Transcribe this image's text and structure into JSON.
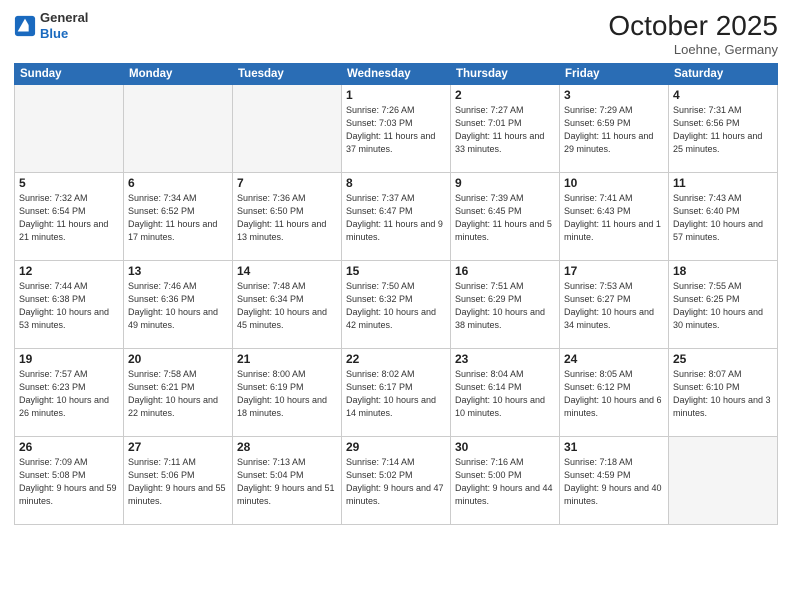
{
  "header": {
    "logo_general": "General",
    "logo_blue": "Blue",
    "month_title": "October 2025",
    "location": "Loehne, Germany"
  },
  "weekdays": [
    "Sunday",
    "Monday",
    "Tuesday",
    "Wednesday",
    "Thursday",
    "Friday",
    "Saturday"
  ],
  "weeks": [
    [
      {
        "day": "",
        "empty": true
      },
      {
        "day": "",
        "empty": true
      },
      {
        "day": "",
        "empty": true
      },
      {
        "day": "1",
        "sunrise": "Sunrise: 7:26 AM",
        "sunset": "Sunset: 7:03 PM",
        "daylight": "Daylight: 11 hours and 37 minutes."
      },
      {
        "day": "2",
        "sunrise": "Sunrise: 7:27 AM",
        "sunset": "Sunset: 7:01 PM",
        "daylight": "Daylight: 11 hours and 33 minutes."
      },
      {
        "day": "3",
        "sunrise": "Sunrise: 7:29 AM",
        "sunset": "Sunset: 6:59 PM",
        "daylight": "Daylight: 11 hours and 29 minutes."
      },
      {
        "day": "4",
        "sunrise": "Sunrise: 7:31 AM",
        "sunset": "Sunset: 6:56 PM",
        "daylight": "Daylight: 11 hours and 25 minutes."
      }
    ],
    [
      {
        "day": "5",
        "sunrise": "Sunrise: 7:32 AM",
        "sunset": "Sunset: 6:54 PM",
        "daylight": "Daylight: 11 hours and 21 minutes."
      },
      {
        "day": "6",
        "sunrise": "Sunrise: 7:34 AM",
        "sunset": "Sunset: 6:52 PM",
        "daylight": "Daylight: 11 hours and 17 minutes."
      },
      {
        "day": "7",
        "sunrise": "Sunrise: 7:36 AM",
        "sunset": "Sunset: 6:50 PM",
        "daylight": "Daylight: 11 hours and 13 minutes."
      },
      {
        "day": "8",
        "sunrise": "Sunrise: 7:37 AM",
        "sunset": "Sunset: 6:47 PM",
        "daylight": "Daylight: 11 hours and 9 minutes."
      },
      {
        "day": "9",
        "sunrise": "Sunrise: 7:39 AM",
        "sunset": "Sunset: 6:45 PM",
        "daylight": "Daylight: 11 hours and 5 minutes."
      },
      {
        "day": "10",
        "sunrise": "Sunrise: 7:41 AM",
        "sunset": "Sunset: 6:43 PM",
        "daylight": "Daylight: 11 hours and 1 minute."
      },
      {
        "day": "11",
        "sunrise": "Sunrise: 7:43 AM",
        "sunset": "Sunset: 6:40 PM",
        "daylight": "Daylight: 10 hours and 57 minutes."
      }
    ],
    [
      {
        "day": "12",
        "sunrise": "Sunrise: 7:44 AM",
        "sunset": "Sunset: 6:38 PM",
        "daylight": "Daylight: 10 hours and 53 minutes."
      },
      {
        "day": "13",
        "sunrise": "Sunrise: 7:46 AM",
        "sunset": "Sunset: 6:36 PM",
        "daylight": "Daylight: 10 hours and 49 minutes."
      },
      {
        "day": "14",
        "sunrise": "Sunrise: 7:48 AM",
        "sunset": "Sunset: 6:34 PM",
        "daylight": "Daylight: 10 hours and 45 minutes."
      },
      {
        "day": "15",
        "sunrise": "Sunrise: 7:50 AM",
        "sunset": "Sunset: 6:32 PM",
        "daylight": "Daylight: 10 hours and 42 minutes."
      },
      {
        "day": "16",
        "sunrise": "Sunrise: 7:51 AM",
        "sunset": "Sunset: 6:29 PM",
        "daylight": "Daylight: 10 hours and 38 minutes."
      },
      {
        "day": "17",
        "sunrise": "Sunrise: 7:53 AM",
        "sunset": "Sunset: 6:27 PM",
        "daylight": "Daylight: 10 hours and 34 minutes."
      },
      {
        "day": "18",
        "sunrise": "Sunrise: 7:55 AM",
        "sunset": "Sunset: 6:25 PM",
        "daylight": "Daylight: 10 hours and 30 minutes."
      }
    ],
    [
      {
        "day": "19",
        "sunrise": "Sunrise: 7:57 AM",
        "sunset": "Sunset: 6:23 PM",
        "daylight": "Daylight: 10 hours and 26 minutes."
      },
      {
        "day": "20",
        "sunrise": "Sunrise: 7:58 AM",
        "sunset": "Sunset: 6:21 PM",
        "daylight": "Daylight: 10 hours and 22 minutes."
      },
      {
        "day": "21",
        "sunrise": "Sunrise: 8:00 AM",
        "sunset": "Sunset: 6:19 PM",
        "daylight": "Daylight: 10 hours and 18 minutes."
      },
      {
        "day": "22",
        "sunrise": "Sunrise: 8:02 AM",
        "sunset": "Sunset: 6:17 PM",
        "daylight": "Daylight: 10 hours and 14 minutes."
      },
      {
        "day": "23",
        "sunrise": "Sunrise: 8:04 AM",
        "sunset": "Sunset: 6:14 PM",
        "daylight": "Daylight: 10 hours and 10 minutes."
      },
      {
        "day": "24",
        "sunrise": "Sunrise: 8:05 AM",
        "sunset": "Sunset: 6:12 PM",
        "daylight": "Daylight: 10 hours and 6 minutes."
      },
      {
        "day": "25",
        "sunrise": "Sunrise: 8:07 AM",
        "sunset": "Sunset: 6:10 PM",
        "daylight": "Daylight: 10 hours and 3 minutes."
      }
    ],
    [
      {
        "day": "26",
        "sunrise": "Sunrise: 7:09 AM",
        "sunset": "Sunset: 5:08 PM",
        "daylight": "Daylight: 9 hours and 59 minutes."
      },
      {
        "day": "27",
        "sunrise": "Sunrise: 7:11 AM",
        "sunset": "Sunset: 5:06 PM",
        "daylight": "Daylight: 9 hours and 55 minutes."
      },
      {
        "day": "28",
        "sunrise": "Sunrise: 7:13 AM",
        "sunset": "Sunset: 5:04 PM",
        "daylight": "Daylight: 9 hours and 51 minutes."
      },
      {
        "day": "29",
        "sunrise": "Sunrise: 7:14 AM",
        "sunset": "Sunset: 5:02 PM",
        "daylight": "Daylight: 9 hours and 47 minutes."
      },
      {
        "day": "30",
        "sunrise": "Sunrise: 7:16 AM",
        "sunset": "Sunset: 5:00 PM",
        "daylight": "Daylight: 9 hours and 44 minutes."
      },
      {
        "day": "31",
        "sunrise": "Sunrise: 7:18 AM",
        "sunset": "Sunset: 4:59 PM",
        "daylight": "Daylight: 9 hours and 40 minutes."
      },
      {
        "day": "",
        "empty": true
      }
    ]
  ]
}
